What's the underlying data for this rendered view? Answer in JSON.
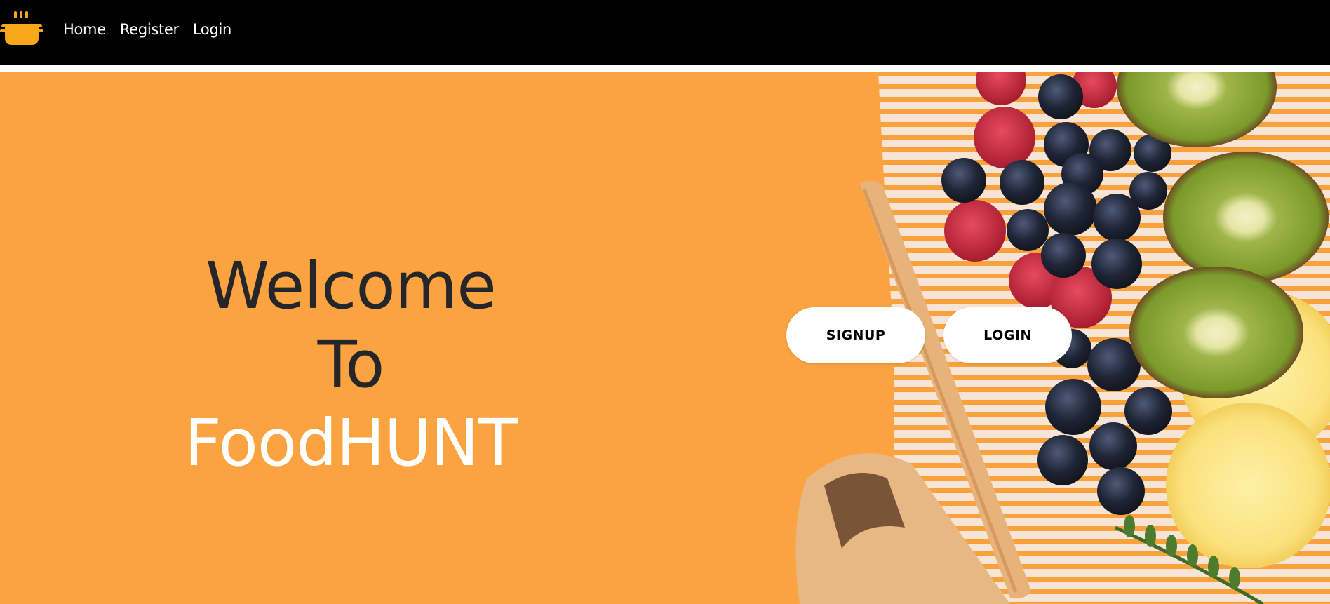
{
  "nav": {
    "logo_icon": "cooking-pot-icon",
    "links": [
      {
        "label": "Home"
      },
      {
        "label": "Register"
      },
      {
        "label": "Login"
      }
    ]
  },
  "hero": {
    "welcome_line1": "Welcome",
    "welcome_line2": "To",
    "welcome_line3": "FoodHUNT",
    "signup_label": "SIGNUP",
    "login_label": "LOGIN",
    "background_description": "orange backdrop with fruit and wafer food photo"
  },
  "colors": {
    "navbar": "#000000",
    "accent_orange": "#fba341",
    "logo_orange": "#f9a81b",
    "text_dark": "#25262a",
    "text_light": "#ffffff"
  }
}
